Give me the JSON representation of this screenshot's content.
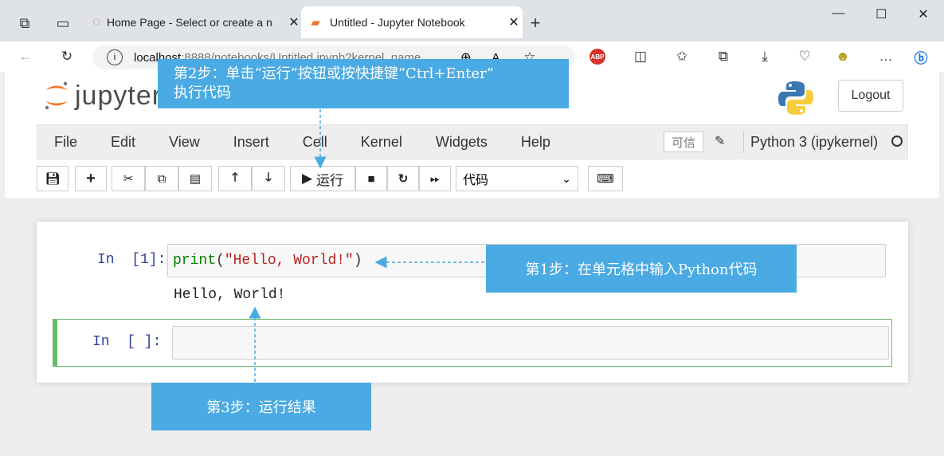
{
  "browser": {
    "tabs": [
      {
        "title": "Home Page - Select or create a n"
      },
      {
        "title": "Untitled - Jupyter Notebook",
        "active": true
      }
    ],
    "url_host": "localhost",
    "url_path": ":8888/notebooks/Untitled.ipynb?kernel_name..."
  },
  "header": {
    "logo_text": "jupyter",
    "logout_label": "Logout"
  },
  "menubar": {
    "items": [
      "File",
      "Edit",
      "View",
      "Insert",
      "Cell",
      "Kernel",
      "Widgets",
      "Help"
    ],
    "trusted": "可信",
    "kernel_name": "Python 3 (ipykernel)"
  },
  "toolbar": {
    "run_label": "运行",
    "cell_type": "代码"
  },
  "cells": [
    {
      "prompt": "In  [1]:",
      "code_func": "print",
      "code_open": "(",
      "code_string": "\"Hello, World!\"",
      "code_close": ")",
      "output": "Hello, World!"
    },
    {
      "prompt": "In  [ ]:",
      "code": ""
    }
  ],
  "annotations": {
    "step2_line1": "第2步：单击“运行”按钮或按快捷键“Ctrl+Enter”",
    "step2_line2": "执行代码",
    "step1": "第1步：在单元格中输入Python代码",
    "step3": "第3步：运行结果"
  },
  "colors": {
    "annotation_bg": "#4aaae3",
    "selected_cell_border": "#66bb6a",
    "prompt_color": "#303f9f"
  }
}
